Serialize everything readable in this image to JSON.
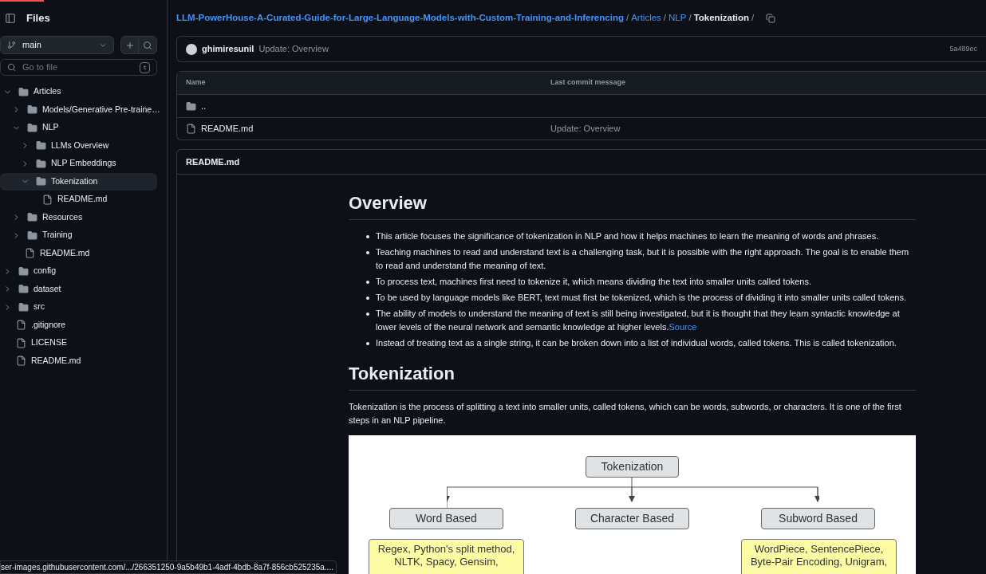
{
  "sidebar": {
    "title": "Files",
    "branch": "main",
    "search": {
      "placeholder": "Go to file",
      "shortcut": "t"
    },
    "tree": [
      {
        "kind": "folder",
        "name": "Articles",
        "expanded": true,
        "selected": false,
        "children": [
          {
            "kind": "folder",
            "name": "Models/Generative Pre-traine…",
            "expanded": false,
            "selected": false
          },
          {
            "kind": "folder",
            "name": "NLP",
            "expanded": true,
            "selected": false,
            "children": [
              {
                "kind": "folder",
                "name": "LLMs Overview",
                "expanded": false,
                "selected": false
              },
              {
                "kind": "folder",
                "name": "NLP Embeddings",
                "expanded": false,
                "selected": false
              },
              {
                "kind": "folder",
                "name": "Tokenization",
                "expanded": true,
                "selected": true,
                "children": [
                  {
                    "kind": "file",
                    "name": "README.md",
                    "selected": false
                  }
                ]
              }
            ]
          },
          {
            "kind": "folder",
            "name": "Resources",
            "expanded": false,
            "selected": false
          },
          {
            "kind": "folder",
            "name": "Training",
            "expanded": false,
            "selected": false
          },
          {
            "kind": "file",
            "name": "README.md",
            "selected": false
          }
        ]
      },
      {
        "kind": "folder",
        "name": "config",
        "expanded": false,
        "selected": false
      },
      {
        "kind": "folder",
        "name": "dataset",
        "expanded": false,
        "selected": false
      },
      {
        "kind": "folder",
        "name": "src",
        "expanded": false,
        "selected": false
      },
      {
        "kind": "file",
        "name": ".gitignore",
        "selected": false
      },
      {
        "kind": "file",
        "name": "LICENSE",
        "selected": false
      },
      {
        "kind": "file",
        "name": "README.md",
        "selected": false
      }
    ]
  },
  "breadcrumb": {
    "links": [
      "LLM-PowerHouse-A-Curated-Guide-for-Large-Language-Models-with-Custom-Training-and-Inferencing",
      "Articles",
      "NLP"
    ],
    "current": "Tokenization",
    "separator": "/"
  },
  "commit": {
    "author": "ghimiresunil",
    "message": "Update: Overview",
    "hash": "5a489ec"
  },
  "table": {
    "columns": [
      "Name",
      "Last commit message"
    ],
    "rows": [
      {
        "kind": "parent",
        "name": "..",
        "message": ""
      },
      {
        "kind": "file",
        "name": "README.md",
        "message": "Update: Overview"
      }
    ]
  },
  "readme": {
    "title": "README.md",
    "sections": [
      {
        "heading": "Overview",
        "bullets": [
          {
            "text": "This article focuses the significance of tokenization in NLP and how it helps machines to learn the meaning of words and phrases."
          },
          {
            "text": "Teaching machines to read and understand text is a challenging task, but it is possible with the right approach. The goal is to enable them to read and understand the meaning of text."
          },
          {
            "text": "To process text, machines first need to tokenize it, which means dividing the text into smaller units called tokens."
          },
          {
            "text": "To be used by language models like BERT, text must first be tokenized, which is the process of dividing it into smaller units called tokens."
          },
          {
            "text": "The ability of models to understand the meaning of text is still being investigated, but it is thought that they learn syntactic knowledge at lower levels of the neural network and semantic knowledge at higher levels.",
            "link": "Source"
          },
          {
            "text": "Instead of treating text as a single string, it can be broken down into a list of individual words, called tokens. This is called tokenization."
          }
        ]
      },
      {
        "heading": "Tokenization",
        "paragraph": "Tokenization is the process of splitting a text into smaller units, called tokens, which can be words, subwords, or characters. It is one of the first steps in an NLP pipeline."
      }
    ],
    "diagram": {
      "root": "Tokenization",
      "branches": [
        {
          "label": "Word Based",
          "examples": [
            "Regex, Python's split method,",
            "NLTK, Spacy, Gensim,"
          ]
        },
        {
          "label": "Character Based"
        },
        {
          "label": "Subword Based",
          "examples": [
            "WordPiece, SentencePiece,",
            "Byte-Pair Encoding, Unigram,"
          ]
        }
      ]
    }
  },
  "status_url": "ser-images.githubusercontent.com/.../266351250-9a5b49b1-4adf-4bdb-8a7f-856cb525235a...."
}
